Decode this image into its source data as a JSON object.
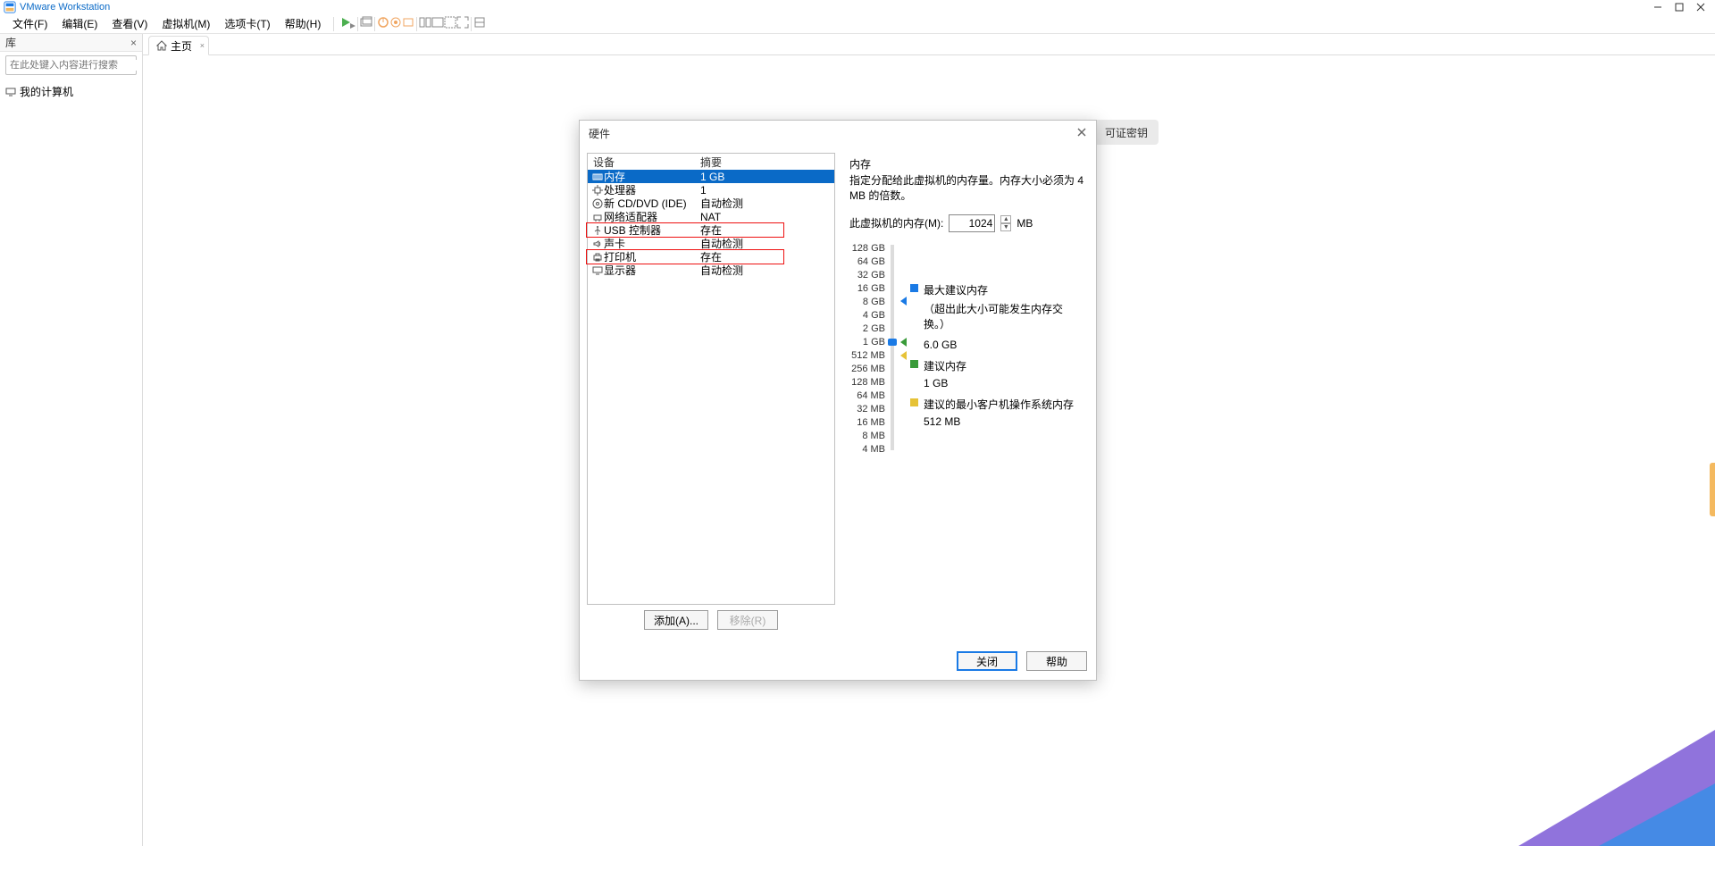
{
  "app": {
    "title": "VMware Workstation"
  },
  "menu": [
    "文件(F)",
    "编辑(E)",
    "查看(V)",
    "虚拟机(M)",
    "选项卡(T)",
    "帮助(H)"
  ],
  "toolbar": {
    "icons": [
      "play",
      "pause",
      "snap",
      "rec",
      "stop",
      "rew",
      "layout1",
      "layout2",
      "fit",
      "full",
      "grid",
      "link"
    ]
  },
  "sidebar": {
    "title": "库",
    "search_placeholder": "在此处键入内容进行搜索",
    "tree": [
      {
        "label": "我的计算机"
      }
    ]
  },
  "tabs": [
    {
      "label": "主页"
    }
  ],
  "background_button": "可证密钥",
  "dialog": {
    "title": "硬件",
    "columns": {
      "device": "设备",
      "summary": "摘要"
    },
    "devices": [
      {
        "icon": "mem",
        "name": "内存",
        "summary": "1 GB",
        "selected": true
      },
      {
        "icon": "cpu",
        "name": "处理器",
        "summary": "1"
      },
      {
        "icon": "cd",
        "name": "新 CD/DVD (IDE)",
        "summary": "自动检测"
      },
      {
        "icon": "net",
        "name": "网络适配器",
        "summary": "NAT"
      },
      {
        "icon": "usb",
        "name": "USB 控制器",
        "summary": "存在",
        "boxed": true
      },
      {
        "icon": "sound",
        "name": "声卡",
        "summary": "自动检测"
      },
      {
        "icon": "printer",
        "name": "打印机",
        "summary": "存在",
        "boxed": true
      },
      {
        "icon": "display",
        "name": "显示器",
        "summary": "自动检测"
      }
    ],
    "buttons": {
      "add": "添加(A)...",
      "remove": "移除(R)",
      "close": "关闭",
      "help": "帮助"
    },
    "memory": {
      "heading": "内存",
      "description": "指定分配给此虚拟机的内存量。内存大小必须为 4 MB 的倍数。",
      "field_label": "此虚拟机的内存(M):",
      "value": "1024",
      "unit": "MB",
      "scale": [
        "128 GB",
        "64 GB",
        "32 GB",
        "16 GB",
        "8 GB",
        "4 GB",
        "2 GB",
        "1 GB",
        "512 MB",
        "256 MB",
        "128 MB",
        "64 MB",
        "32 MB",
        "16 MB",
        "8 MB",
        "4 MB"
      ],
      "legend": {
        "max": {
          "title": "最大建议内存",
          "note": "（超出此大小可能发生内存交换。）",
          "value": "6.0 GB"
        },
        "recommended": {
          "title": "建议内存",
          "value": "1 GB"
        },
        "min": {
          "title": "建议的最小客户机操作系统内存",
          "value": "512 MB"
        }
      }
    }
  }
}
